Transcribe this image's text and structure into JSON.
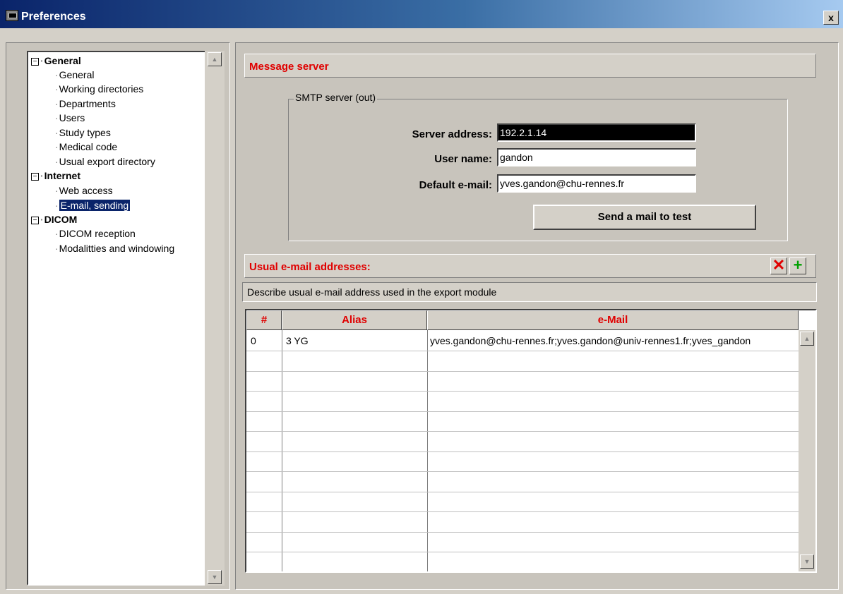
{
  "window": {
    "title": "Preferences",
    "close_label": "x"
  },
  "tree": {
    "groups": [
      {
        "label": "General",
        "expander": "−",
        "items": [
          "General",
          "Working directories",
          "Departments",
          "Users",
          "Study types",
          "Medical code",
          "Usual export directory"
        ]
      },
      {
        "label": "Internet",
        "expander": "−",
        "items": [
          "Web access",
          "E-mail, sending"
        ]
      },
      {
        "label": "DICOM",
        "expander": "−",
        "items": [
          "DICOM reception",
          "Modalitties and windowing"
        ]
      }
    ],
    "selected": "E-mail, sending"
  },
  "message_server": {
    "header": "Message server",
    "group_label": "SMTP server (out)",
    "server_address_label": "Server address:",
    "server_address": "192.2.1.14",
    "user_name_label": "User name:",
    "user_name": "gandon",
    "default_email_label": "Default e-mail:",
    "default_email": "yves.gandon@chu-rennes.fr",
    "send_test_label": "Send a mail to test"
  },
  "addresses": {
    "header": "Usual e-mail addresses:",
    "delete_icon": "delete-icon",
    "add_icon": "add-icon",
    "description": "Describe usual e-mail address used in the export module",
    "columns": [
      "#",
      "Alias",
      "e-Mail"
    ],
    "rows": [
      {
        "index": "0",
        "alias": "3 YG",
        "email": "yves.gandon@chu-rennes.fr;yves.gandon@univ-rennes1.fr;yves_gandon"
      }
    ]
  },
  "colors": {
    "accent_red": "#e00000",
    "selection": "#0a246a",
    "title_gradient_start": "#0a246a"
  }
}
